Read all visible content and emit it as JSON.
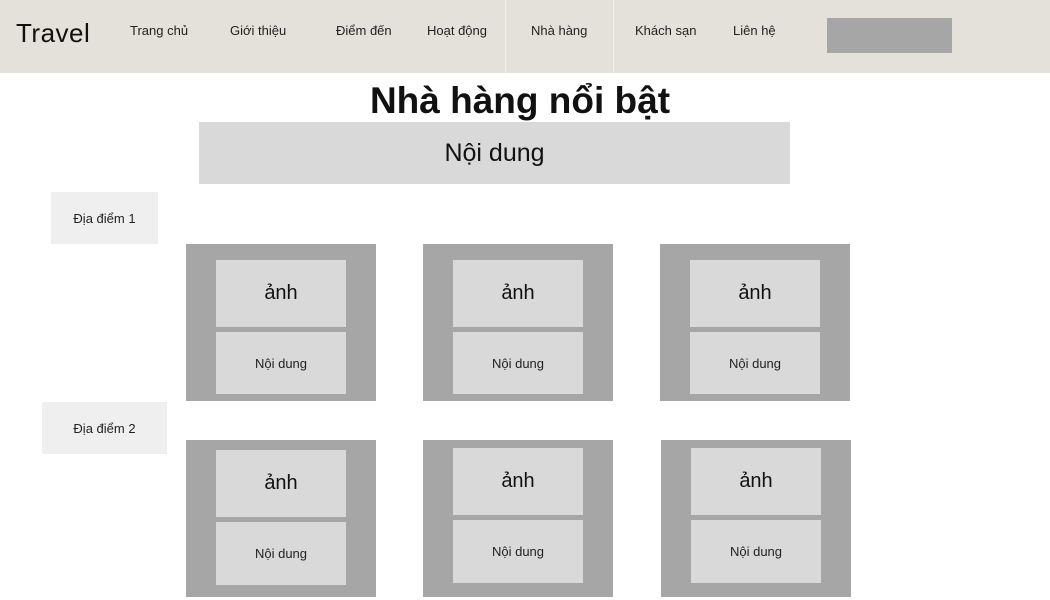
{
  "header": {
    "logo": "Travel",
    "nav": [
      {
        "label": "Trang chủ"
      },
      {
        "label": "Giới thiệu"
      },
      {
        "label": "Điểm đến"
      },
      {
        "label": "Hoạt động"
      },
      {
        "label": "Nhà hàng"
      },
      {
        "label": "Khách sạn"
      },
      {
        "label": "Liên hệ"
      }
    ],
    "search_placeholder": ""
  },
  "main": {
    "title": "Nhà hàng nổi bật",
    "intro": "Nội dung",
    "locations": [
      {
        "label": "Địa điểm 1",
        "cards": [
          {
            "image": "ảnh",
            "content": "Nội dung"
          },
          {
            "image": "ảnh",
            "content": "Nội dung"
          },
          {
            "image": "ảnh",
            "content": "Nội dung"
          }
        ]
      },
      {
        "label": "Địa điểm 2",
        "cards": [
          {
            "image": "ảnh",
            "content": "Nội dung"
          },
          {
            "image": "ảnh",
            "content": "Nội dung"
          },
          {
            "image": "ảnh",
            "content": "Nội dung"
          }
        ]
      }
    ]
  },
  "colors": {
    "navbar_bg": "#e4e1db",
    "search_bg": "#a6a6a6",
    "card_bg": "#a6a6a6",
    "panel_bg": "#d9d9d9",
    "label_bg": "#efefef"
  }
}
